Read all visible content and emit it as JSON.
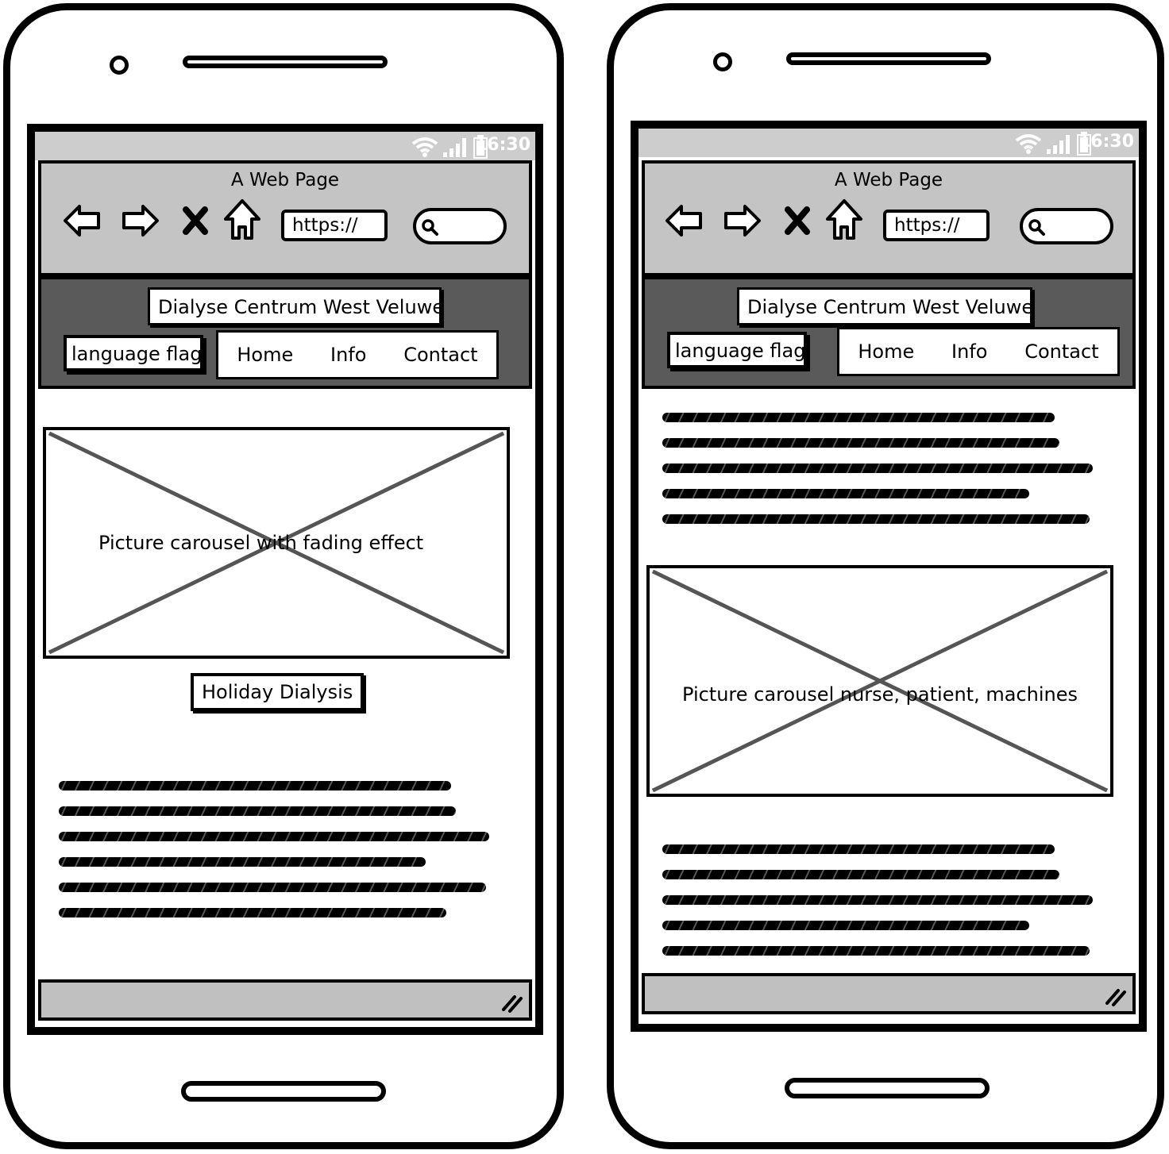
{
  "status_bar": {
    "time": "16:30"
  },
  "browser": {
    "title": "A Web Page",
    "url": "https://"
  },
  "site": {
    "title": "Dialyse Centrum West Veluwe",
    "language_flag": "language flag",
    "nav": [
      "Home",
      "Info",
      "Contact"
    ]
  },
  "screens": {
    "left": {
      "carousel_label": "Picture carousel with fading effect",
      "section_button": "Holiday Dialysis"
    },
    "right": {
      "carousel_label": "Picture carousel nurse, patient, machines"
    }
  },
  "icons": [
    "back-arrow-icon",
    "forward-arrow-icon",
    "close-icon",
    "home-icon",
    "search-icon",
    "wifi-icon",
    "signal-icon",
    "battery-icon",
    "resize-grip-icon"
  ]
}
